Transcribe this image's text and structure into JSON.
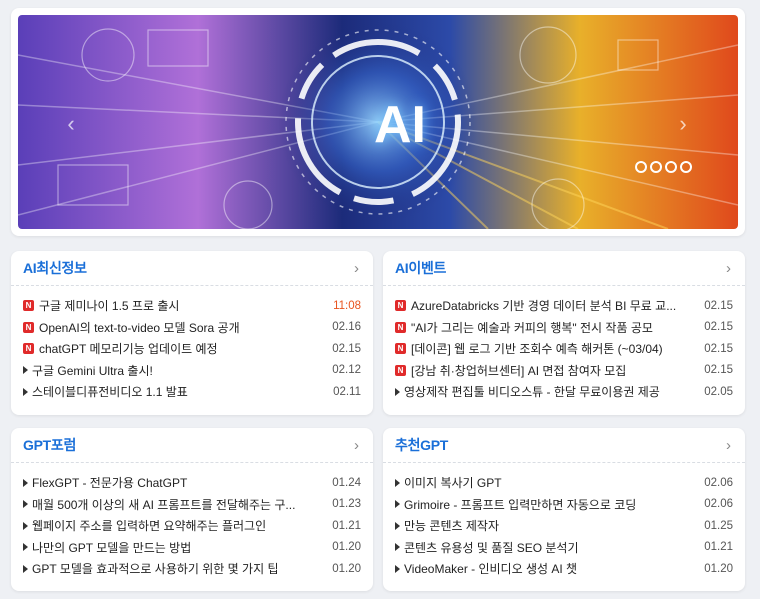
{
  "banner": {
    "text": "AI"
  },
  "panels": [
    {
      "title": "AI최신정보",
      "items": [
        {
          "title": "구글 제미나이 1.5 프로 출시",
          "date": "11:08",
          "new": true,
          "today": true
        },
        {
          "title": "OpenAI의 text-to-video 모델 Sora 공개",
          "date": "02.16",
          "new": true
        },
        {
          "title": "chatGPT 메모리기능 업데이트 예정",
          "date": "02.15",
          "new": true
        },
        {
          "title": "구글 Gemini Ultra 출시!",
          "date": "02.12",
          "new": false
        },
        {
          "title": "스테이블디퓨전비디오 1.1 발표",
          "date": "02.11",
          "new": false
        }
      ]
    },
    {
      "title": "AI이벤트",
      "items": [
        {
          "title": "AzureDatabricks 기반 경영 데이터 분석 BI 무료 교...",
          "date": "02.15",
          "new": true
        },
        {
          "title": "\"AI가 그리는 예술과 커피의 행복\" 전시 작품 공모",
          "date": "02.15",
          "new": true
        },
        {
          "title": "[데이콘] 웹 로그 기반 조회수 예측 해커톤 (~03/04)",
          "date": "02.15",
          "new": true
        },
        {
          "title": "[강남 취·창업허브센터] AI 면접 참여자 모집",
          "date": "02.15",
          "new": true
        },
        {
          "title": "영상제작 편집툴 비디오스튜 - 한달 무료이용권 제공",
          "date": "02.05",
          "new": false
        }
      ]
    },
    {
      "title": "GPT포럼",
      "items": [
        {
          "title": "FlexGPT - 전문가용 ChatGPT",
          "date": "01.24",
          "new": false
        },
        {
          "title": "매월 500개 이상의 새 AI 프롬프트를 전달해주는 구...",
          "date": "01.23",
          "new": false
        },
        {
          "title": "웹페이지 주소를 입력하면 요약해주는 플러그인",
          "date": "01.21",
          "new": false
        },
        {
          "title": "나만의 GPT 모델을 만드는 방법",
          "date": "01.20",
          "new": false
        },
        {
          "title": "GPT 모델을 효과적으로 사용하기 위한 몇 가지 팁",
          "date": "01.20",
          "new": false
        }
      ]
    },
    {
      "title": "추천GPT",
      "items": [
        {
          "title": "이미지 복사기 GPT",
          "date": "02.06",
          "new": false
        },
        {
          "title": "Grimoire - 프롬프트 입력만하면 자동으로 코딩",
          "date": "02.06",
          "new": false
        },
        {
          "title": "만능 콘텐츠 제작자",
          "date": "01.25",
          "new": false
        },
        {
          "title": "콘텐츠 유용성 및 품질 SEO 분석기",
          "date": "01.21",
          "new": false
        },
        {
          "title": "VideoMaker - 인비디오 생성 AI 챗",
          "date": "01.20",
          "new": false
        }
      ]
    }
  ],
  "icons": {
    "more": "chevron-right-icon",
    "new": "new-badge-icon",
    "bullet": "triangle-right-icon",
    "prev": "chevron-left-icon",
    "next": "chevron-right-icon"
  },
  "colors": {
    "accent": "#1a6fd8",
    "new_badge": "#e02a2a",
    "today": "#e8541f"
  }
}
